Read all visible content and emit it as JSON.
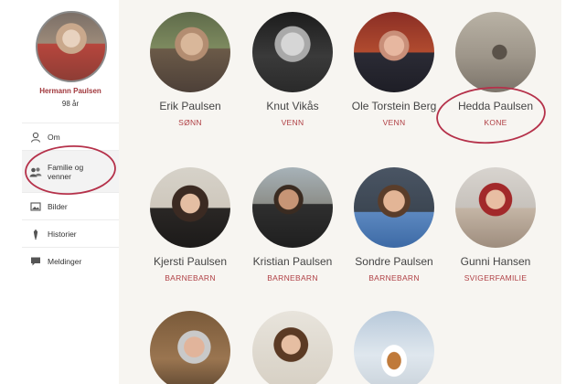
{
  "profile": {
    "name": "Hermann Paulsen",
    "age": "98 år"
  },
  "menu": [
    {
      "label": "Om",
      "icon": "person-icon"
    },
    {
      "label": "Familie og venner",
      "icon": "people-icon"
    },
    {
      "label": "Bilder",
      "icon": "photos-icon"
    },
    {
      "label": "Historier",
      "icon": "pen-icon"
    },
    {
      "label": "Meldinger",
      "icon": "chat-icon"
    }
  ],
  "members": [
    {
      "name": "Erik Paulsen",
      "relation": "SØNN"
    },
    {
      "name": "Knut Vikås",
      "relation": "VENN"
    },
    {
      "name": "Ole Torstein Berg",
      "relation": "VENN"
    },
    {
      "name": "Hedda Paulsen",
      "relation": "KONE"
    },
    {
      "name": "Kjersti Paulsen",
      "relation": "BARNEBARN"
    },
    {
      "name": "Kristian Paulsen",
      "relation": "BARNEBARN"
    },
    {
      "name": "Sondre Paulsen",
      "relation": "BARNEBARN"
    },
    {
      "name": "Gunni Hansen",
      "relation": "SVIGERFAMILIE"
    }
  ],
  "colors": {
    "accent": "#b04045",
    "annotation": "#b5314a",
    "background": "#f7f5f1"
  }
}
